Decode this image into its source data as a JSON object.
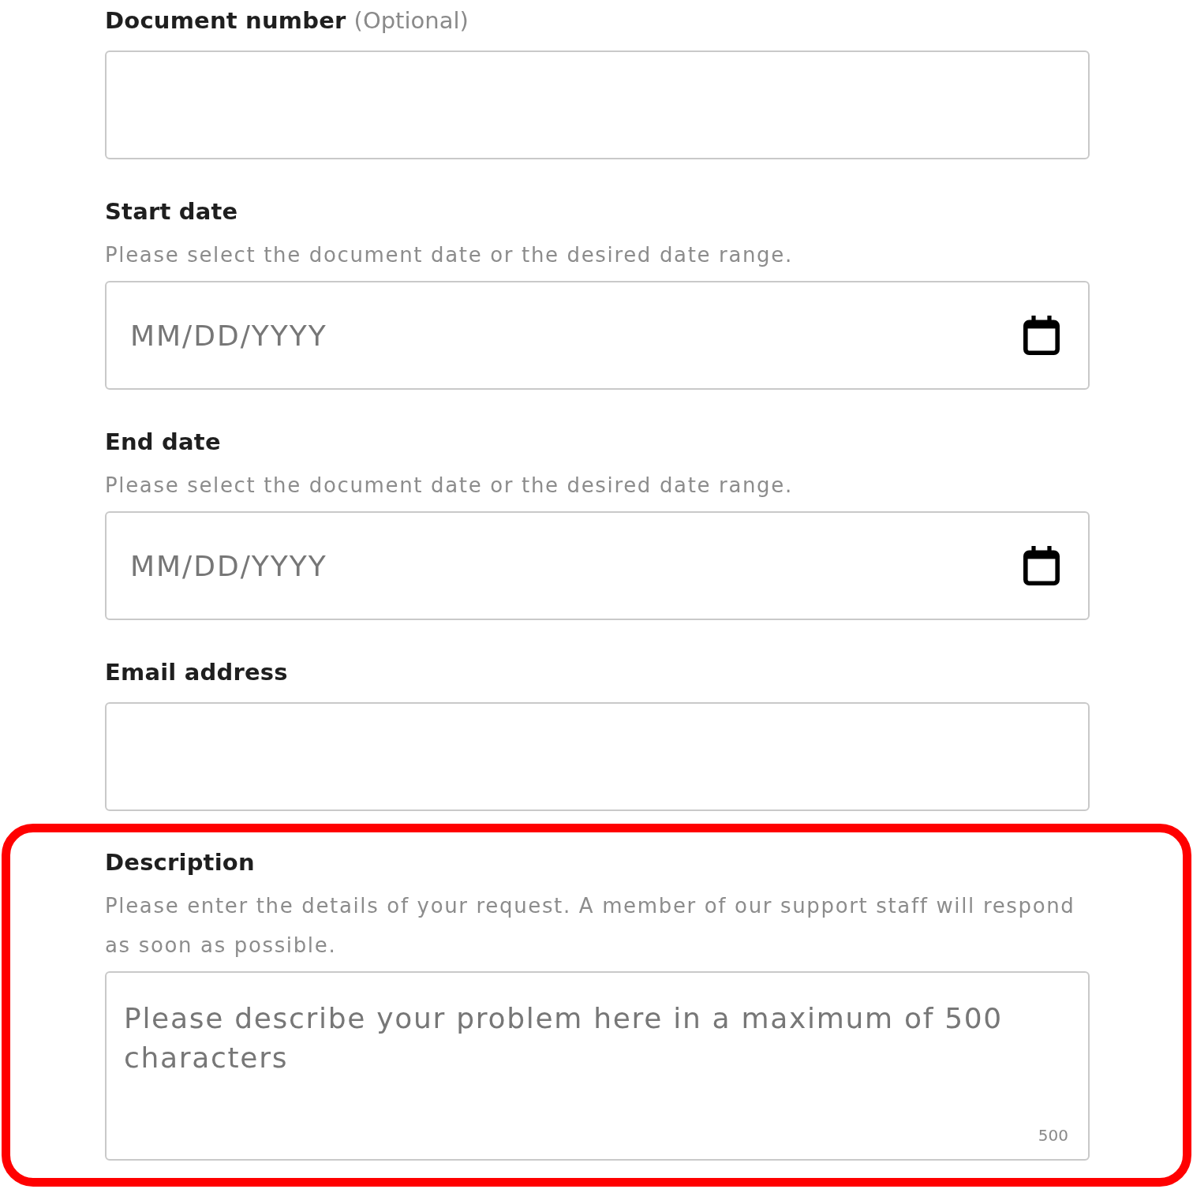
{
  "fields": [
    {
      "kind": "text",
      "label": "Document number",
      "optional_note": "(Optional)",
      "highlighted": false
    },
    {
      "kind": "date",
      "label": "Start date",
      "hint": "Please select the document date or the desired date range.",
      "placeholder": "MM/DD/YYYY",
      "highlighted": false
    },
    {
      "kind": "date",
      "label": "End date",
      "hint": "Please select the document date or the desired date range.",
      "placeholder": "MM/DD/YYYY",
      "highlighted": false
    },
    {
      "kind": "text",
      "label": "Email address",
      "highlighted": false
    },
    {
      "kind": "textarea",
      "label": "Description",
      "hint": "Please enter the details of your request. A member of our support staff will respond as soon as possible.",
      "placeholder": "Please describe your problem here in a maximum of 500 characters",
      "counter": "500",
      "highlighted": true
    }
  ]
}
